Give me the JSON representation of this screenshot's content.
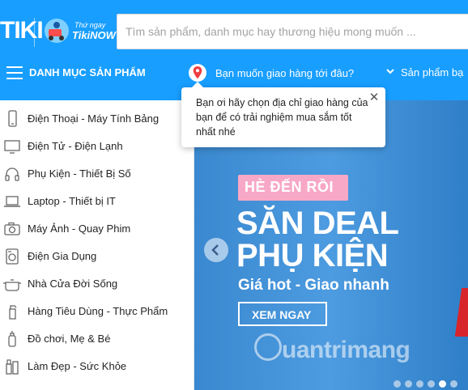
{
  "header": {
    "logo_text": "TIKI",
    "now_tagline": "Thứ ngay",
    "now_brand": "TikiNOW",
    "search_placeholder": "Tìm sản phẩm, danh mục hay thương hiệu mong muốn ..."
  },
  "navbar": {
    "categories_title": "DANH MỤC SẢN PHẨM",
    "delivery_question": "Bạn muốn giao hàng tới đâu?",
    "products_link": "Sản phẩm bạ"
  },
  "tooltip": {
    "text": "Bạn ơi hãy chọn địa chỉ giao hàng của bạn để có trải nghiệm mua sắm tốt nhất nhé",
    "close_symbol": "✕"
  },
  "sidebar": {
    "items": [
      {
        "label": "Điện Thoại - Máy Tính Bảng",
        "icon": "phone-icon"
      },
      {
        "label": "Điện Tử - Điện Lạnh",
        "icon": "tv-icon"
      },
      {
        "label": "Phụ Kiện - Thiết Bị Số",
        "icon": "headphones-icon"
      },
      {
        "label": "Laptop - Thiết bị IT",
        "icon": "laptop-icon"
      },
      {
        "label": "Máy Ảnh - Quay Phim",
        "icon": "camera-icon"
      },
      {
        "label": "Điện Gia Dụng",
        "icon": "washing-machine-icon"
      },
      {
        "label": "Nhà Cửa Đời Sống",
        "icon": "pot-icon"
      },
      {
        "label": "Hàng Tiêu Dùng - Thực Phẩm",
        "icon": "spray-bottle-icon"
      },
      {
        "label": "Đồ chơi, Mẹ & Bé",
        "icon": "baby-bottle-icon"
      },
      {
        "label": "Làm Đẹp - Sức Khỏe",
        "icon": "cosmetics-icon"
      }
    ]
  },
  "banner": {
    "badge": "HÈ ĐẾN RỒI",
    "headline_line1": "SĂN DEAL",
    "headline_line2": "PHỤ KIỆN",
    "subline": "Giá hot - Giao nhanh",
    "cta": "XEM NGAY",
    "watermark": "uantrimang",
    "dot_count": 6
  },
  "colors": {
    "brand_blue": "#189eff",
    "banner_blue": "#4d9be0",
    "badge_pink": "#f7a8c6",
    "pin_red": "#ef3e42"
  }
}
